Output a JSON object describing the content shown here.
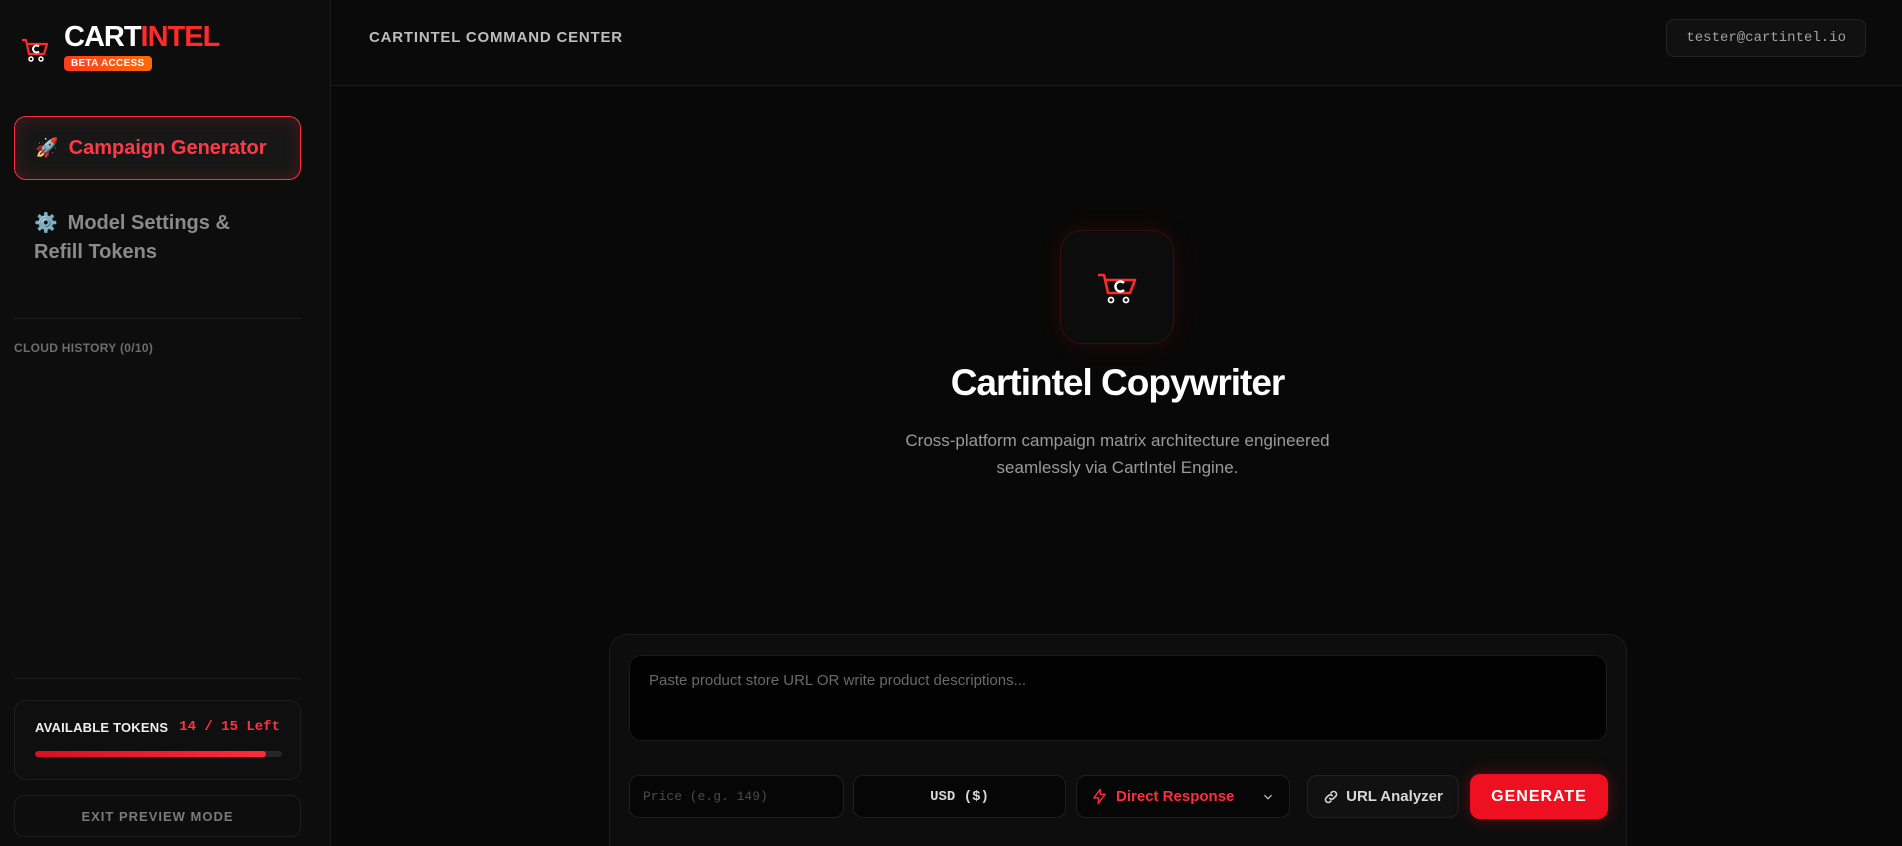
{
  "brand": {
    "name_main": "CART",
    "name_accent": "INTEL",
    "badge": "BETA ACCESS",
    "logo_icon": "cart-c-icon",
    "accent_color": "#ff2a2a"
  },
  "sidebar": {
    "items": [
      {
        "icon": "🚀",
        "icon_name": "rocket-icon",
        "label": "Campaign Generator",
        "active": true
      },
      {
        "icon": "⚙️",
        "icon_name": "gear-icon",
        "label": "Model Settings & Refill Tokens",
        "active": false
      }
    ],
    "history_label": "CLOUD HISTORY (0/10)",
    "tokens": {
      "title": "AVAILABLE TOKENS",
      "count_text": "14 / 15 Left",
      "used": 14,
      "total": 15
    },
    "exit_label": "EXIT PREVIEW MODE"
  },
  "header": {
    "title": "CARTINTEL COMMAND CENTER",
    "user_email": "tester@cartintel.io"
  },
  "hero": {
    "title": "Cartintel Copywriter",
    "subtitle": "Cross-platform campaign matrix architecture engineered seamlessly via CartIntel Engine."
  },
  "composer": {
    "textarea_placeholder": "Paste product store URL OR write product descriptions...",
    "price_placeholder": "Price (e.g. 149)",
    "currency_value": "USD ($)",
    "mode_value": "Direct Response",
    "url_button_label": "URL Analyzer",
    "generate_label": "GENERATE"
  },
  "colors": {
    "primary_red": "#ee1020",
    "background": "#080808"
  }
}
